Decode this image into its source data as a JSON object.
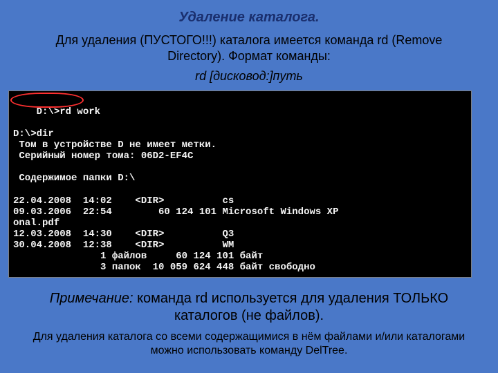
{
  "title": "Удаление каталога.",
  "intro": "Для удаления (ПУСТОГО!!!) каталога имеется команда rd (Remove Directory). Формат команды:",
  "cmdfmt": "rd [дисковод:]путь",
  "term": {
    "l1": "D:\\>rd work",
    "l2": "",
    "l3": "D:\\>dir",
    "l4": " Том в устройстве D не имеет метки.",
    "l5": " Серийный номер тома: 06D2-EF4C",
    "l6": "",
    "l7": " Содержимое папки D:\\",
    "l8": "",
    "l9": "22.04.2008  14:02    <DIR>          cs",
    "l10": "09.03.2006  22:54        60 124 101 Microsoft Windows XP",
    "l11": "onal.pdf",
    "l12": "12.03.2008  14:30    <DIR>          Q3",
    "l13": "30.04.2008  12:38    <DIR>          WM",
    "l14": "               1 файлов     60 124 101 байт",
    "l15": "               3 папок  10 059 624 448 байт свободно"
  },
  "note_lead": "Примечание:",
  "note_body": " команда rd используется для удаления ТОЛЬКО каталогов (не файлов).",
  "note2": "Для удаления каталога со всеми содержащимися в нём файлами и/или каталогами можно использовать команду DelTree."
}
